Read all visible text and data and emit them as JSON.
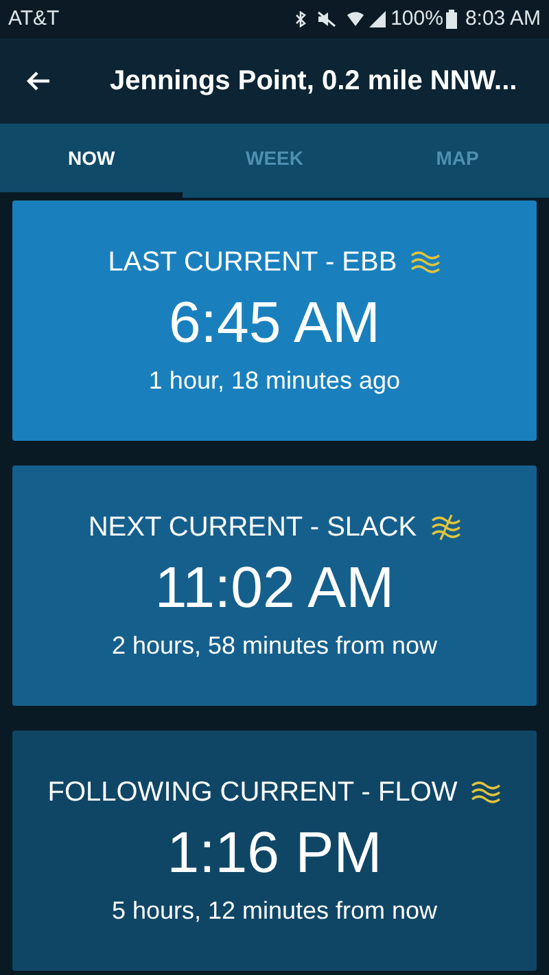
{
  "status_bar": {
    "carrier": "AT&T",
    "battery": "100%",
    "time": "8:03 AM"
  },
  "app_bar": {
    "title": "Jennings Point, 0.2 mile NNW..."
  },
  "tabs": [
    {
      "label": "NOW",
      "selected": true
    },
    {
      "label": "WEEK",
      "selected": false
    },
    {
      "label": "MAP",
      "selected": false
    }
  ],
  "cards": [
    {
      "heading": "LAST CURRENT - EBB",
      "kind": "waves",
      "time": "6:45 AM",
      "relative": "1 hour, 18 minutes ago",
      "color": "#1a80bd"
    },
    {
      "heading": "NEXT CURRENT - SLACK",
      "kind": "slack",
      "time": "11:02 AM",
      "relative": "2 hours, 58 minutes from now",
      "color": "#155f8c"
    },
    {
      "heading": "FOLLOWING CURRENT - FLOW",
      "kind": "waves",
      "time": "1:16 PM",
      "relative": "5 hours, 12 minutes from now",
      "color": "#0f4666"
    }
  ]
}
